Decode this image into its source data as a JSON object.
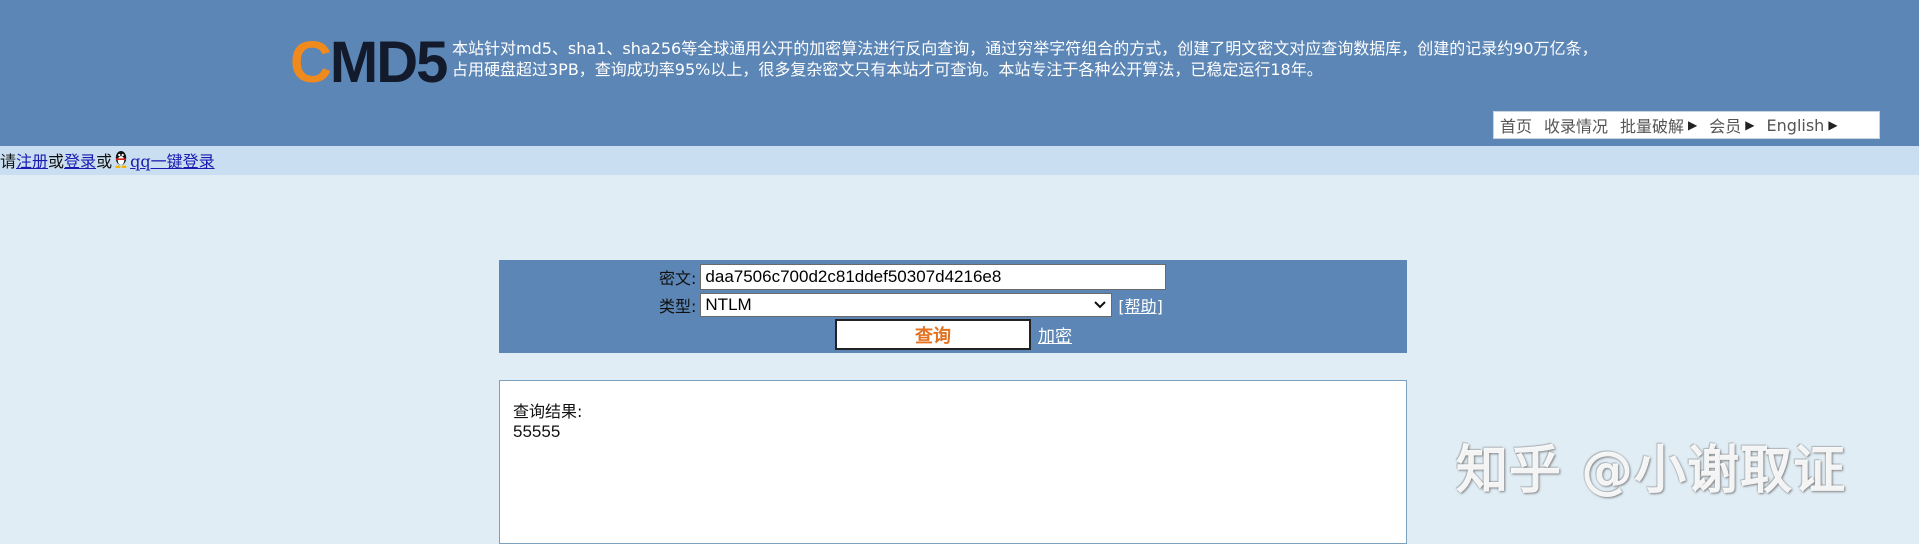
{
  "header": {
    "logo": {
      "first_letter": "C",
      "rest": "MD5"
    },
    "intro_line1": "本站针对md5、sha1、sha256等全球通用公开的加密算法进行反向查询，通过穷举字符组合的方式，创建了明文密文对应查询数据库，创建的记录约90万亿条，",
    "intro_line2": "占用硬盘超过3PB，查询成功率95%以上，很多复杂密文只有本站才可查询。本站专注于各种公开算法，已稳定运行18年。",
    "nav": {
      "home": "首页",
      "records": "收录情况",
      "batch": "批量破解",
      "member": "会员",
      "english": "English"
    }
  },
  "login_bar": {
    "prefix": "请",
    "register": "注册",
    "or1": "或",
    "login": "登录",
    "or2": "或",
    "qq_login": "qq一键登录"
  },
  "form": {
    "ciphertext_label": "密文:",
    "ciphertext_value": "daa7506c700d2c81ddef50307d4216e8",
    "type_label": "类型:",
    "type_value": "NTLM",
    "help_link": "[帮助]",
    "query_button": "查询",
    "encrypt_link": "加密"
  },
  "result": {
    "label": "查询结果:",
    "value": "55555"
  },
  "watermark": "知乎 @小谢取证",
  "colors": {
    "header_bg": "#5b86b5",
    "page_bg": "#e1edf5",
    "login_bar_bg": "#c9def0",
    "logo_accent": "#f08a1d",
    "query_button_text": "#e3711f"
  },
  "icons": [
    "qq-penguin-icon",
    "triangle-right-icon",
    "chevron-down-icon"
  ]
}
